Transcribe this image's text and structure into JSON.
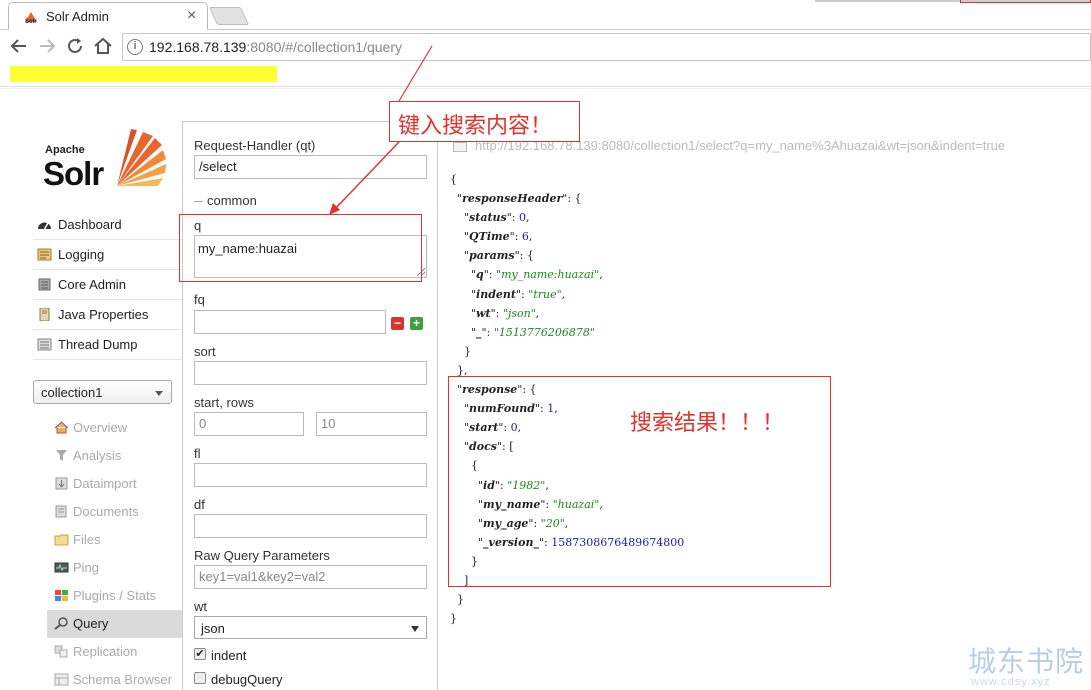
{
  "browser": {
    "tab_title": "Solr Admin",
    "tab_close": "×",
    "url_host": "192.168.78.139",
    "url_rest": ":8080/#/collection1/query",
    "info_icon": "i"
  },
  "sidebar": {
    "logo_apache": "Apache",
    "logo_solr": "Solr",
    "menu": [
      {
        "label": "Dashboard",
        "icon": "dashboard-icon"
      },
      {
        "label": "Logging",
        "icon": "logging-icon"
      },
      {
        "label": "Core Admin",
        "icon": "core-admin-icon"
      },
      {
        "label": "Java Properties",
        "icon": "java-properties-icon"
      },
      {
        "label": "Thread Dump",
        "icon": "thread-dump-icon"
      }
    ],
    "core_selector": "collection1",
    "core_menu": [
      {
        "label": "Overview"
      },
      {
        "label": "Analysis"
      },
      {
        "label": "Dataimport"
      },
      {
        "label": "Documents"
      },
      {
        "label": "Files"
      },
      {
        "label": "Ping"
      },
      {
        "label": "Plugins / Stats"
      },
      {
        "label": "Query"
      },
      {
        "label": "Replication"
      },
      {
        "label": "Schema Browser"
      }
    ]
  },
  "form": {
    "handler_label": "Request-Handler (qt)",
    "handler_value": "/select",
    "section_common": "common",
    "q_label": "q",
    "q_value": "my_name:huazai",
    "fq_label": "fq",
    "sort_label": "sort",
    "start_rows_label": "start, rows",
    "start_value": "0",
    "rows_value": "10",
    "fl_label": "fl",
    "df_label": "df",
    "raw_label": "Raw Query Parameters",
    "raw_placeholder": "key1=val1&key2=val2",
    "wt_label": "wt",
    "wt_value": "json",
    "indent_label": "indent",
    "debug_label": "debugQuery",
    "minus": "−",
    "plus": "+"
  },
  "results": {
    "request_url": "http://192.168.78.139:8080/collection1/select?q=my_name%3Ahuazai&wt=json&indent=true",
    "response": {
      "status": "0",
      "QTime": "6",
      "q": "my_name:huazai",
      "indent": "true",
      "wt": "json",
      "underscore": "1513776206878",
      "numFound": "1",
      "start": "0",
      "id": "1982",
      "my_name": "huazai",
      "my_age": "20",
      "version": "1587308676489674800"
    }
  },
  "annotations": {
    "input_note": "键入搜索内容！",
    "result_note": "搜索结果！！！",
    "color": "#e0332c"
  },
  "watermark": {
    "title": "城东书院",
    "url": "www.cdsy.xyz"
  }
}
